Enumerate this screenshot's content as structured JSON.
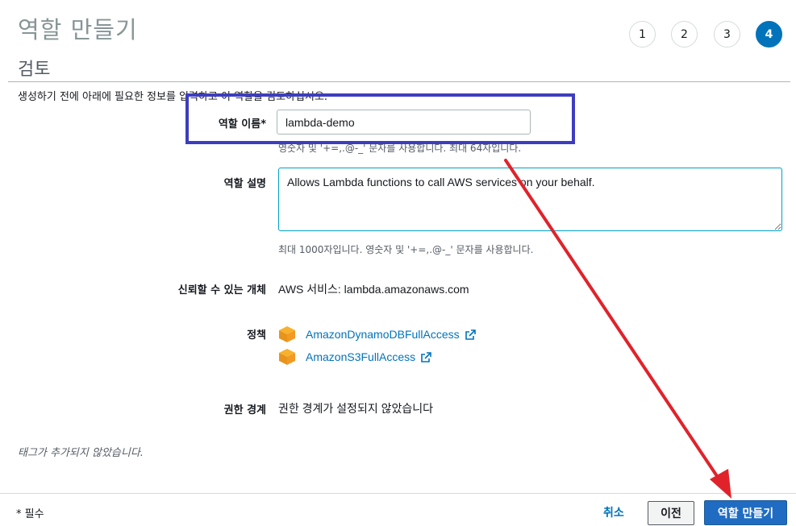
{
  "header": {
    "title": "역할 만들기",
    "subtitle": "검토",
    "description": "생성하기 전에 아래에 필요한 정보를 입력하고 이 역할을 검토하십시오."
  },
  "steps": [
    {
      "label": "1",
      "active": false
    },
    {
      "label": "2",
      "active": false
    },
    {
      "label": "3",
      "active": false
    },
    {
      "label": "4",
      "active": true
    }
  ],
  "form": {
    "role_name_label": "역할 이름*",
    "role_name_value": "lambda-demo",
    "role_name_hint": "영숫자 및 '+=,.@-_' 문자를 사용합니다. 최대 64자입니다.",
    "role_desc_label": "역할 설명",
    "role_desc_value": "Allows Lambda functions to call AWS services on your behalf.",
    "role_desc_hint": "최대 1000자입니다. 영숫자 및 '+=,.@-_' 문자를 사용합니다.",
    "trusted_label": "신뢰할 수 있는 개체",
    "trusted_value": "AWS 서비스: lambda.amazonaws.com",
    "policies_label": "정책",
    "policies": [
      {
        "name": "AmazonDynamoDBFullAccess"
      },
      {
        "name": "AmazonS3FullAccess"
      }
    ],
    "boundary_label": "권한 경계",
    "boundary_value": "권한 경계가 설정되지 않았습니다"
  },
  "tags_note": "태그가 추가되지 않았습니다.",
  "footer": {
    "required_note": "* 필수",
    "cancel_label": "취소",
    "prev_label": "이전",
    "create_label": "역할 만들기"
  },
  "colors": {
    "accent": "#0073bb",
    "primary_button": "#1f6cc2",
    "annotation_box": "#3d3dbf",
    "annotation_arrow": "#e0232b"
  },
  "icons": {
    "policy_icon": "policy-cube-icon",
    "external_link": "external-link-icon"
  }
}
